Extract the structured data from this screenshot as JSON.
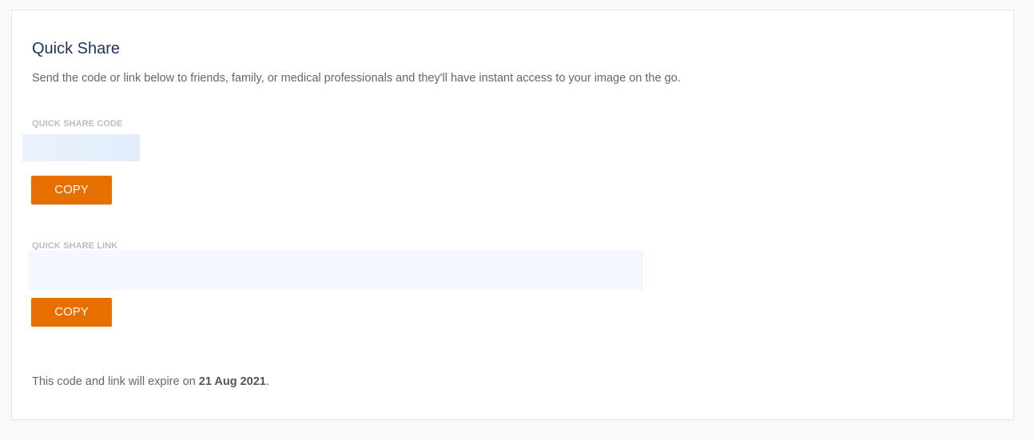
{
  "quick_share": {
    "title": "Quick Share",
    "description": "Send the code or link below to friends, family, or medical professionals and they'll have instant access to your image on the go.",
    "code_label": "QUICK SHARE CODE",
    "code_value": "",
    "copy_code_label": "COPY",
    "link_label": "QUICK SHARE LINK",
    "link_value": "",
    "copy_link_label": "COPY",
    "expiry_prefix": "This code and link will expire on ",
    "expiry_date": "21 Aug 2021",
    "expiry_suffix": "."
  },
  "colors": {
    "title": "#1d3661",
    "accent_button": "#e76f00",
    "label": "#bcbcbc",
    "field_highlight": "#eaf2fd"
  }
}
